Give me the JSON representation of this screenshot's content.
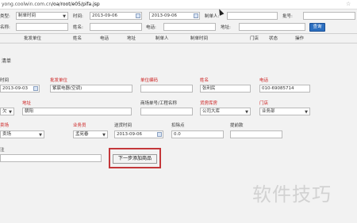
{
  "browser": {
    "url_prefix": "yong.coolwin.com.cn",
    "url_path": "/oa/root/e05/pifa.jsp"
  },
  "filters": {
    "type_label": "类型:",
    "type_value": "制单时间",
    "time_label": "时间:",
    "date_from": "2013-09-06",
    "date_to": "2013-09-06",
    "maker_label": "制单人:",
    "batch_no_label": "批号:",
    "name_label": "名称:",
    "person_name_label": "姓名:",
    "phone_label": "电话:",
    "address_label": "地址:",
    "query_button": "查询"
  },
  "table_header": [
    "",
    "批发单位",
    "姓名",
    "电话",
    "地址",
    "制单人",
    "制单时间",
    "门店",
    "状态",
    "操作"
  ],
  "section_title": "清单",
  "form": {
    "time_label": "时间",
    "time_value": "2013-09-03",
    "unit_label": "批发单位",
    "unit_value": "紫宸电器(空调)",
    "unit_code_label": "单位编码",
    "name_label": "姓名",
    "name_value": "张利民",
    "phone_label": "电话",
    "phone_value": "010-69085714",
    "status_value": "欠",
    "address_label": "地址",
    "address_value": "朝阳",
    "order_no_label": "商场单号/工程名称",
    "warehouse_label": "货房库房",
    "warehouse_value": "公司大库",
    "store_label": "门店",
    "store_value": "业务部",
    "project_label": "卖场",
    "project_value": "卖场",
    "salesman_label": "业务员",
    "salesman_value": "孟宪春",
    "delivery_time_label": "送货时间",
    "delivery_time_value": "2013-09-06",
    "rate_label": "扣除点",
    "rate_value": "0.0",
    "deposit_label": "提前款",
    "remark_label": "注",
    "next_button": "下一步添加商品"
  },
  "watermark": "软件技巧"
}
